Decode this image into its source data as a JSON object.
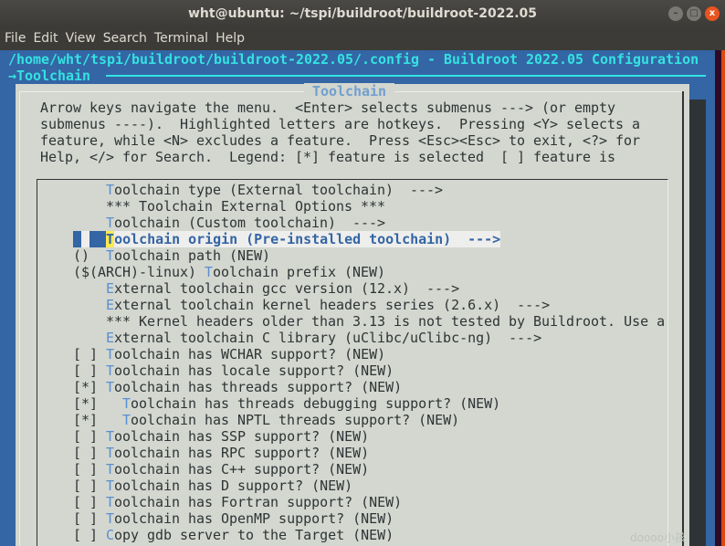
{
  "window": {
    "title": "wht@ubuntu: ~/tspi/buildroot/buildroot-2022.05",
    "controls": [
      "minimize",
      "maximize",
      "close"
    ]
  },
  "menubar": [
    "File",
    "Edit",
    "View",
    "Search",
    "Terminal",
    "Help"
  ],
  "header": {
    "path": "/home/wht/tspi/buildroot/buildroot-2022.05/.config - Buildroot 2022.05 Configuration",
    "breadcrumb": "→Toolchain"
  },
  "dialog": {
    "title": "Toolchain",
    "help": [
      "Arrow keys navigate the menu.  <Enter> selects submenus ---> (or empty",
      "submenus ----).  Highlighted letters are hotkeys.  Pressing <Y> selects a",
      "feature, while <N> excludes a feature.  Press <Esc><Esc> to exit, <?> for",
      "Help, </> for Search.  Legend: [*] feature is selected  [ ] feature is"
    ]
  },
  "menu": [
    {
      "prefix": "",
      "hot": "T",
      "rest": "oolchain type (External toolchain)  --->"
    },
    {
      "prefix": "",
      "hot": "",
      "rest": "*** Toolchain External Options ***"
    },
    {
      "prefix": "",
      "hot": "T",
      "rest": "oolchain (Custom toolchain)  --->"
    },
    {
      "prefix": "",
      "hot": "T",
      "rest": "oolchain origin (Pre-installed toolchain)  --->",
      "selected": true
    },
    {
      "prefix": "()",
      "hot": "T",
      "rest": "oolchain path (NEW)"
    },
    {
      "prefix": "($(ARCH)-linux)",
      "hot": "T",
      "rest": "oolchain prefix (NEW)"
    },
    {
      "prefix": "",
      "hot": "E",
      "rest": "xternal toolchain gcc version (12.x)  --->"
    },
    {
      "prefix": "",
      "hot": "E",
      "rest": "xternal toolchain kernel headers series (2.6.x)  --->"
    },
    {
      "prefix": "",
      "hot": "",
      "rest": "*** Kernel headers older than 3.13 is not tested by Buildroot. Use a"
    },
    {
      "prefix": "",
      "hot": "E",
      "rest": "xternal toolchain C library (uClibc/uClibc-ng)  --->"
    },
    {
      "prefix": "[ ]",
      "hot": "T",
      "rest": "oolchain has WCHAR support? (NEW)"
    },
    {
      "prefix": "[ ]",
      "hot": "T",
      "rest": "oolchain has locale support? (NEW)"
    },
    {
      "prefix": "[*]",
      "hot": "T",
      "rest": "oolchain has threads support? (NEW)"
    },
    {
      "prefix": "[*]",
      "hot": "T",
      "rest": "oolchain has threads debugging support? (NEW)",
      "level": 1
    },
    {
      "prefix": "[*]",
      "hot": "T",
      "rest": "oolchain has NPTL threads support? (NEW)",
      "level": 1
    },
    {
      "prefix": "[ ]",
      "hot": "T",
      "rest": "oolchain has SSP support? (NEW)"
    },
    {
      "prefix": "[ ]",
      "hot": "T",
      "rest": "oolchain has RPC support? (NEW)"
    },
    {
      "prefix": "[ ]",
      "hot": "T",
      "rest": "oolchain has C++ support? (NEW)"
    },
    {
      "prefix": "[ ]",
      "hot": "T",
      "rest": "oolchain has D support? (NEW)"
    },
    {
      "prefix": "[ ]",
      "hot": "T",
      "rest": "oolchain has Fortran support? (NEW)"
    },
    {
      "prefix": "[ ]",
      "hot": "T",
      "rest": "oolchain has OpenMP support? (NEW)"
    },
    {
      "prefix": "[ ]",
      "hot": "C",
      "rest": "opy gdb server to the Target (NEW)"
    }
  ],
  "watermark": "doooo小孩",
  "colors": {
    "terminal_bg": "#3465a4",
    "dialog_bg": "#d3d7cf",
    "hotkey": "#5a8ed0",
    "header": "#34e2e2",
    "selected_hotkey_bg": "#fce94f"
  }
}
